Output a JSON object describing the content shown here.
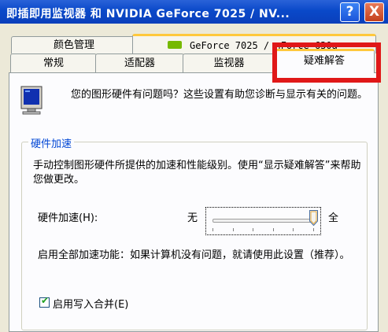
{
  "window": {
    "title": "即插即用监视器 和 NVIDIA GeForce 7025 / NV...",
    "help_glyph": "?",
    "close_glyph": "X"
  },
  "tabs": {
    "row_back": [
      {
        "label": "颜色管理"
      },
      {
        "label": "GeForce 7025 / nForce 630a"
      }
    ],
    "row_front": [
      {
        "label": "常规"
      },
      {
        "label": "适配器"
      },
      {
        "label": "监视器"
      },
      {
        "label": "疑难解答",
        "selected": true
      }
    ]
  },
  "intro": {
    "text": "您的图形硬件有问题吗？这些设置有助您诊断与显示有关的问题。"
  },
  "hardware_acceleration": {
    "group_title": "硬件加速",
    "description": "手动控制图形硬件所提供的加速和性能级别。使用“显示疑难解答”来帮助您做更改。",
    "label": "硬件加速(H):",
    "min_label": "无",
    "max_label": "全",
    "level_fraction": 1.0,
    "tick_count": 6,
    "full_accel_text": "启用全部加速功能：如果计算机没有问题，就请使用此设置（推荐）。"
  },
  "write_combining": {
    "label": "启用写入合并(E)",
    "checked": true
  },
  "highlight_color": "#e01818"
}
